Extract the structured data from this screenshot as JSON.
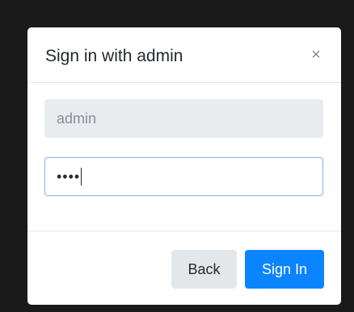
{
  "modal": {
    "title": "Sign in with admin",
    "close_glyph": "×",
    "username": {
      "value": "admin",
      "readonly": true
    },
    "password": {
      "masked_value": "••••"
    },
    "buttons": {
      "back_label": "Back",
      "signin_label": "Sign In"
    }
  },
  "icons": {
    "close": "close-icon"
  },
  "colors": {
    "primary": "#0a84ff",
    "secondary_bg": "#e4e7ea",
    "focus_border": "#80bdff",
    "backdrop": "#1a1a1a"
  }
}
